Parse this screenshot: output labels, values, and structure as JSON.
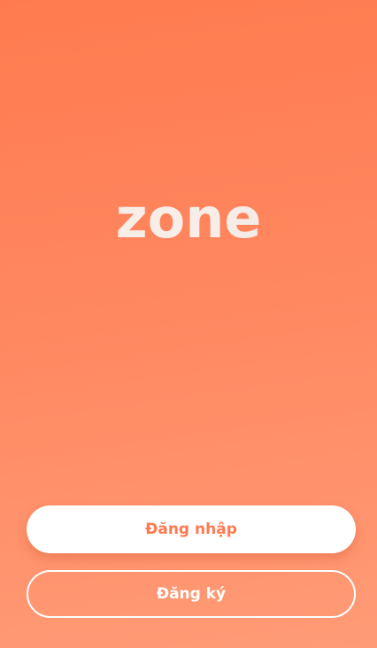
{
  "app": {
    "logo_text": "zone"
  },
  "actions": {
    "login_label": "Đăng nhập",
    "register_label": "Đăng ký"
  },
  "colors": {
    "gradient_top": "#ff7b4f",
    "gradient_bottom": "#ff9b77",
    "button_primary_bg": "#ffffff",
    "button_primary_text": "#ff7a4e",
    "button_outline": "#ffffff"
  }
}
